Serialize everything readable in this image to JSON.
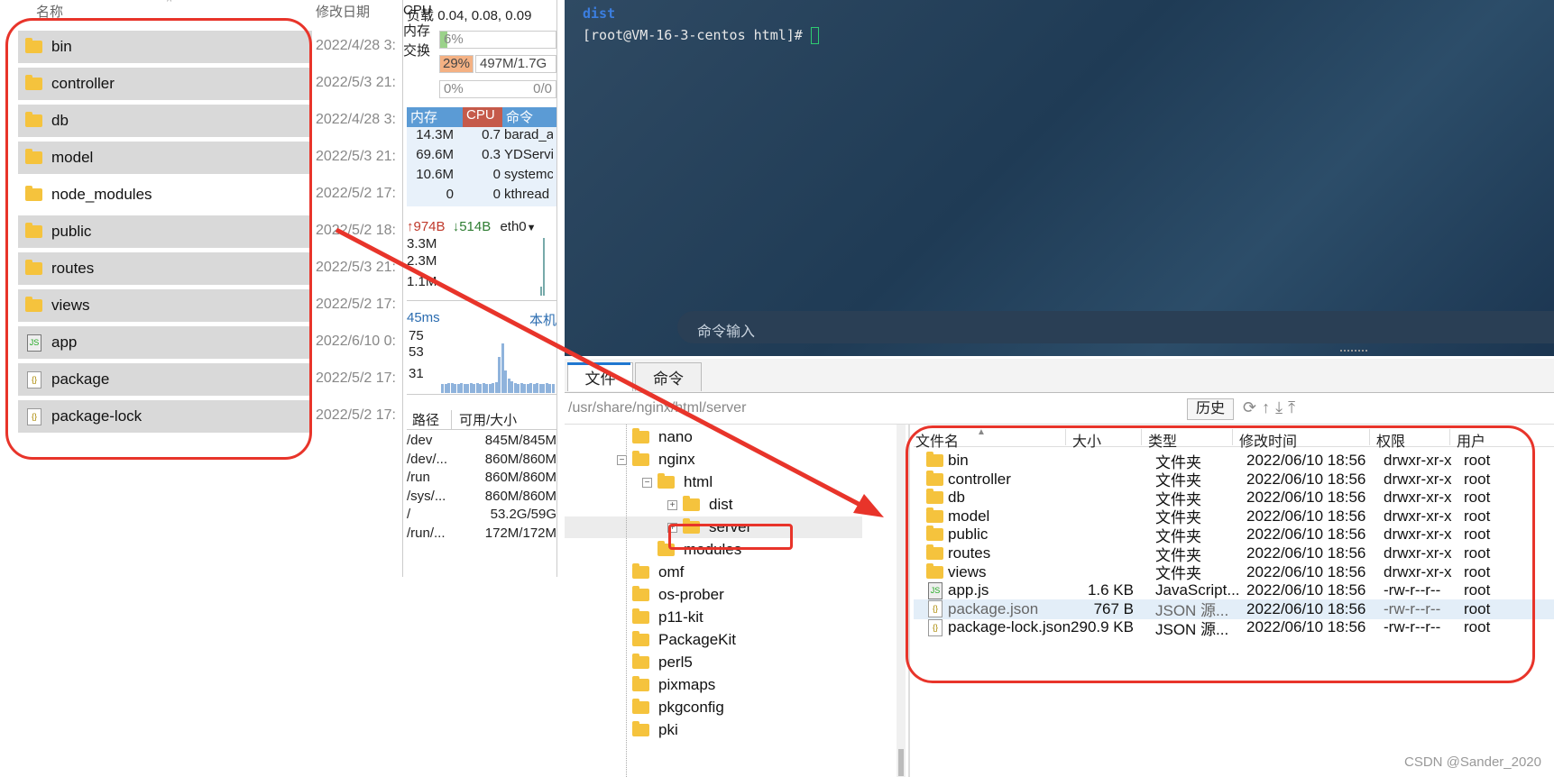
{
  "left_explorer": {
    "col_name": "名称",
    "col_modified": "修改日期",
    "items": [
      {
        "name": "bin",
        "type": "folder",
        "date": "2022/4/28 3:"
      },
      {
        "name": "controller",
        "type": "folder",
        "date": "2022/5/3 21:"
      },
      {
        "name": "db",
        "type": "folder",
        "date": "2022/4/28 3:"
      },
      {
        "name": "model",
        "type": "folder",
        "date": "2022/5/3 21:"
      },
      {
        "name": "node_modules",
        "type": "folder",
        "date": "2022/5/2 17:"
      },
      {
        "name": "public",
        "type": "folder",
        "date": "2022/5/2 18:"
      },
      {
        "name": "routes",
        "type": "folder",
        "date": "2022/5/3 21:"
      },
      {
        "name": "views",
        "type": "folder",
        "date": "2022/5/2 17:"
      },
      {
        "name": "app",
        "type": "js",
        "date": "2022/6/10 0:"
      },
      {
        "name": "package",
        "type": "json",
        "date": "2022/5/2 17:"
      },
      {
        "name": "package-lock",
        "type": "json",
        "date": "2022/5/2 17:"
      }
    ]
  },
  "monitor": {
    "load_label": "负载",
    "load_value": "0.04, 0.08, 0.09",
    "cpu_label": "CPU",
    "cpu_value": "6%",
    "cpu_percent": 6,
    "mem_label": "内存",
    "mem_value": "29%",
    "mem_percent": 29,
    "mem_detail": "497M/1.7G",
    "swap_label": "交换",
    "swap_value": "0%",
    "swap_detail": "0/0",
    "proc_headers": [
      "内存",
      "CPU",
      "命令"
    ],
    "processes": [
      {
        "mem": "14.3M",
        "cpu": "0.7",
        "cmd": "barad_a"
      },
      {
        "mem": "69.6M",
        "cpu": "0.3",
        "cmd": "YDServi"
      },
      {
        "mem": "10.6M",
        "cpu": "0",
        "cmd": "systemc"
      },
      {
        "mem": "0",
        "cpu": "0",
        "cmd": "kthread"
      }
    ],
    "net_up": "974B",
    "net_down": "514B",
    "net_iface": "eth0",
    "net_ticks": [
      "3.3M",
      "2.3M",
      "1.1M"
    ],
    "ping_ms": "45ms",
    "ping_host": "本机",
    "ping_ticks": [
      "75",
      "53",
      "31"
    ],
    "disk_headers": [
      "路径",
      "可用/大小"
    ],
    "disks": [
      {
        "path": "/dev",
        "size": "845M/845M"
      },
      {
        "path": "/dev/...",
        "size": "860M/860M"
      },
      {
        "path": "/run",
        "size": "860M/860M"
      },
      {
        "path": "/sys/...",
        "size": "860M/860M"
      },
      {
        "path": "/",
        "size": "53.2G/59G"
      },
      {
        "path": "/run/...",
        "size": "172M/172M"
      }
    ]
  },
  "terminal": {
    "line1": "dist",
    "prompt": "[root@VM-16-3-centos html]# ",
    "input_placeholder": "命令输入"
  },
  "sftp": {
    "tabs": [
      "文件",
      "命令"
    ],
    "path": "/usr/share/nginx/html/server",
    "history_button": "历史",
    "tree": [
      {
        "label": "nano",
        "level": 0
      },
      {
        "label": "nginx",
        "level": 0,
        "expanded": true
      },
      {
        "label": "html",
        "level": 1,
        "expanded": true
      },
      {
        "label": "dist",
        "level": 2
      },
      {
        "label": "server",
        "level": 2,
        "selected": true
      },
      {
        "label": "modules",
        "level": 1
      },
      {
        "label": "omf",
        "level": 0
      },
      {
        "label": "os-prober",
        "level": 0
      },
      {
        "label": "p11-kit",
        "level": 0
      },
      {
        "label": "PackageKit",
        "level": 0
      },
      {
        "label": "perl5",
        "level": 0
      },
      {
        "label": "pixmaps",
        "level": 0
      },
      {
        "label": "pkgconfig",
        "level": 0
      },
      {
        "label": "pki",
        "level": 0
      }
    ],
    "columns": [
      "文件名",
      "大小",
      "类型",
      "修改时间",
      "权限",
      "用户"
    ],
    "files": [
      {
        "name": "bin",
        "icon": "folder",
        "size": "",
        "type": "文件夹",
        "mtime": "2022/06/10 18:56",
        "perm": "drwxr-xr-x",
        "user": "root"
      },
      {
        "name": "controller",
        "icon": "folder",
        "size": "",
        "type": "文件夹",
        "mtime": "2022/06/10 18:56",
        "perm": "drwxr-xr-x",
        "user": "root"
      },
      {
        "name": "db",
        "icon": "folder",
        "size": "",
        "type": "文件夹",
        "mtime": "2022/06/10 18:56",
        "perm": "drwxr-xr-x",
        "user": "root"
      },
      {
        "name": "model",
        "icon": "folder",
        "size": "",
        "type": "文件夹",
        "mtime": "2022/06/10 18:56",
        "perm": "drwxr-xr-x",
        "user": "root"
      },
      {
        "name": "public",
        "icon": "folder",
        "size": "",
        "type": "文件夹",
        "mtime": "2022/06/10 18:56",
        "perm": "drwxr-xr-x",
        "user": "root"
      },
      {
        "name": "routes",
        "icon": "folder",
        "size": "",
        "type": "文件夹",
        "mtime": "2022/06/10 18:56",
        "perm": "drwxr-xr-x",
        "user": "root"
      },
      {
        "name": "views",
        "icon": "folder",
        "size": "",
        "type": "文件夹",
        "mtime": "2022/06/10 18:56",
        "perm": "drwxr-xr-x",
        "user": "root"
      },
      {
        "name": "app.js",
        "icon": "js",
        "size": "1.6 KB",
        "type": "JavaScript...",
        "mtime": "2022/06/10 18:56",
        "perm": "-rw-r--r--",
        "user": "root"
      },
      {
        "name": "package.json",
        "icon": "json",
        "size": "767 B",
        "type": "JSON 源...",
        "mtime": "2022/06/10 18:56",
        "perm": "-rw-r--r--",
        "user": "root"
      },
      {
        "name": "package-lock.json",
        "icon": "json",
        "size": "290.9 KB",
        "type": "JSON 源...",
        "mtime": "2022/06/10 18:56",
        "perm": "-rw-r--r--",
        "user": "root"
      }
    ]
  },
  "watermark": "CSDN @Sander_2020",
  "colors": {
    "annotation_red": "#e8342a",
    "folder_yellow": "#f5c33d",
    "mem_bar": "#f4b183",
    "proc_header_blue": "#5b9bd5",
    "proc_header_red": "#c55a4a"
  }
}
